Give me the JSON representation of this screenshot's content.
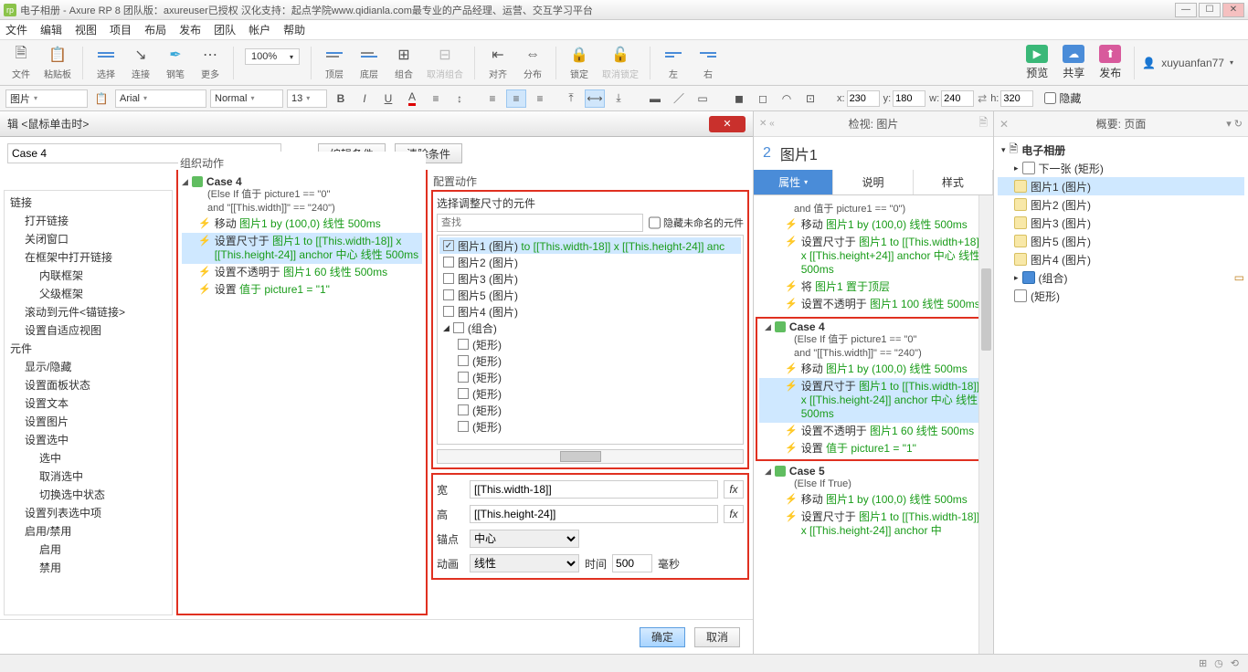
{
  "title": "电子相册 - Axure RP 8 团队版：axureuser已授权 汉化支持：起点学院www.qidianla.com最专业的产品经理、运营、交互学习平台",
  "menus": [
    "文件",
    "编辑",
    "视图",
    "项目",
    "布局",
    "发布",
    "团队",
    "帐户",
    "帮助"
  ],
  "tb1": {
    "file": "文件",
    "paste": "粘贴板",
    "select": "选择",
    "connect": "连接",
    "pen": "钢笔",
    "more": "更多",
    "zoom": "100%",
    "top": "顶层",
    "bottom": "底层",
    "group": "组合",
    "ungroup": "取消组合",
    "align": "对齐",
    "distribute": "分布",
    "lock": "锁定",
    "unlock": "取消锁定",
    "left": "左",
    "right": "右",
    "preview": "预览",
    "share": "共享",
    "publish": "发布",
    "user": "xuyuanfan77"
  },
  "tb2": {
    "elementType": "图片",
    "font": "Arial",
    "weight": "Normal",
    "size": "13",
    "x_label": "x:",
    "x": "230",
    "y_label": "y:",
    "y": "180",
    "w_label": "w:",
    "w": "240",
    "h_label": "h:",
    "h": "320",
    "hidden": "隐藏"
  },
  "dialog": {
    "title": "辑 <鼠标单击时>",
    "caseName": "Case 4",
    "editCond": "编辑条件",
    "clearCond": "清除条件",
    "colOrg": "组织动作",
    "colCfg": "配置动作",
    "left": [
      "链接",
      "打开链接",
      "关闭窗口",
      "在框架中打开链接",
      "内联框架",
      "父级框架",
      "滚动到元件<锚链接>",
      "设置自适应视图",
      "元件",
      "显示/隐藏",
      "设置面板状态",
      "设置文本",
      "设置图片",
      "设置选中",
      "选中",
      "取消选中",
      "切换选中状态",
      "设置列表选中项",
      "启用/禁用",
      "启用",
      "禁用"
    ],
    "case": {
      "name": "Case 4",
      "cond1": "(Else If 值于 picture1 == \"0\"",
      "cond2": "and \"[[This.width]]\" == \"240\")",
      "a1_pre": "移动 ",
      "a1_g": "图片1 by (100,0) 线性 500ms",
      "a2_pre": "设置尺寸于 ",
      "a2_g": "图片1 to [[This.width-18]] x [[This.height-24]] anchor 中心 线性 500ms",
      "a3_pre": "设置不透明于 ",
      "a3_g": "图片1 60 线性 500ms",
      "a4_pre": "设置 ",
      "a4_g": "值于 picture1 = \"1\""
    },
    "cfg": {
      "title": "选择调整尺寸的元件",
      "searchPH": "查找",
      "hideUnnamed": "隐藏未命名的元件",
      "tree_p1_a": "图片1 (图片) ",
      "tree_p1_b": "to [[This.width-18]] x [[This.height-24]] anc",
      "tree": [
        "图片2 (图片)",
        "图片3 (图片)",
        "图片5 (图片)",
        "图片4 (图片)",
        "(组合)",
        "(矩形)",
        "(矩形)",
        "(矩形)",
        "(矩形)",
        "(矩形)",
        "(矩形)"
      ],
      "wlab": "宽",
      "wval": "[[This.width-18]]",
      "hlab": "高",
      "hval": "[[This.height-24]]",
      "anchorlab": "锚点",
      "anchor": "中心",
      "animlab": "动画",
      "anim": "线性",
      "timelab": "时间",
      "time": "500",
      "ms": "毫秒"
    },
    "ok": "确定",
    "cancel": "取消"
  },
  "inspector": {
    "head": "检视: 图片",
    "objNum": "2",
    "objName": "图片1",
    "tabs": [
      "属性",
      "说明",
      "样式"
    ],
    "pre": {
      "l0": "and 值于 picture1 == \"0\")",
      "l1a": "移动 ",
      "l1b": "图片1 by (100,0) 线性 500ms",
      "l2a": "设置尺寸于 ",
      "l2b": "图片1 to [[This.width+18]] x [[This.height+24]] anchor 中心 线性 500ms",
      "l3a": "将 ",
      "l3b": "图片1 置于顶层",
      "l4a": "设置不透明于 ",
      "l4b": "图片1 100 线性 500ms"
    },
    "c4": {
      "name": "Case 4",
      "c1": "(Else If 值于 picture1 == \"0\"",
      "c2": "and \"[[This.width]]\" == \"240\")",
      "a1a": "移动 ",
      "a1b": "图片1 by (100,0) 线性 500ms",
      "a2a": "设置尺寸于 ",
      "a2b": "图片1 to [[This.width-18]] x [[This.height-24]] anchor 中心 线性 500ms",
      "a3a": "设置不透明于 ",
      "a3b": "图片1 60 线性 500ms",
      "a4a": "设置 ",
      "a4b": "值于 picture1 = \"1\""
    },
    "c5": {
      "name": "Case 5",
      "c1": "(Else If True)",
      "a1a": "移动 ",
      "a1b": "图片1 by (100,0) 线性 500ms",
      "a2a": "设置尺寸于 ",
      "a2b": "图片1 to [[This.width-18]] x [[This.height-24]] anchor 中"
    }
  },
  "outline": {
    "head": "概要: 页面",
    "root": "电子相册",
    "next": "下一张 (矩形)",
    "items": [
      "图片1 (图片)",
      "图片2 (图片)",
      "图片3 (图片)",
      "图片5 (图片)",
      "图片4 (图片)",
      "(组合)",
      "(矩形)"
    ]
  }
}
